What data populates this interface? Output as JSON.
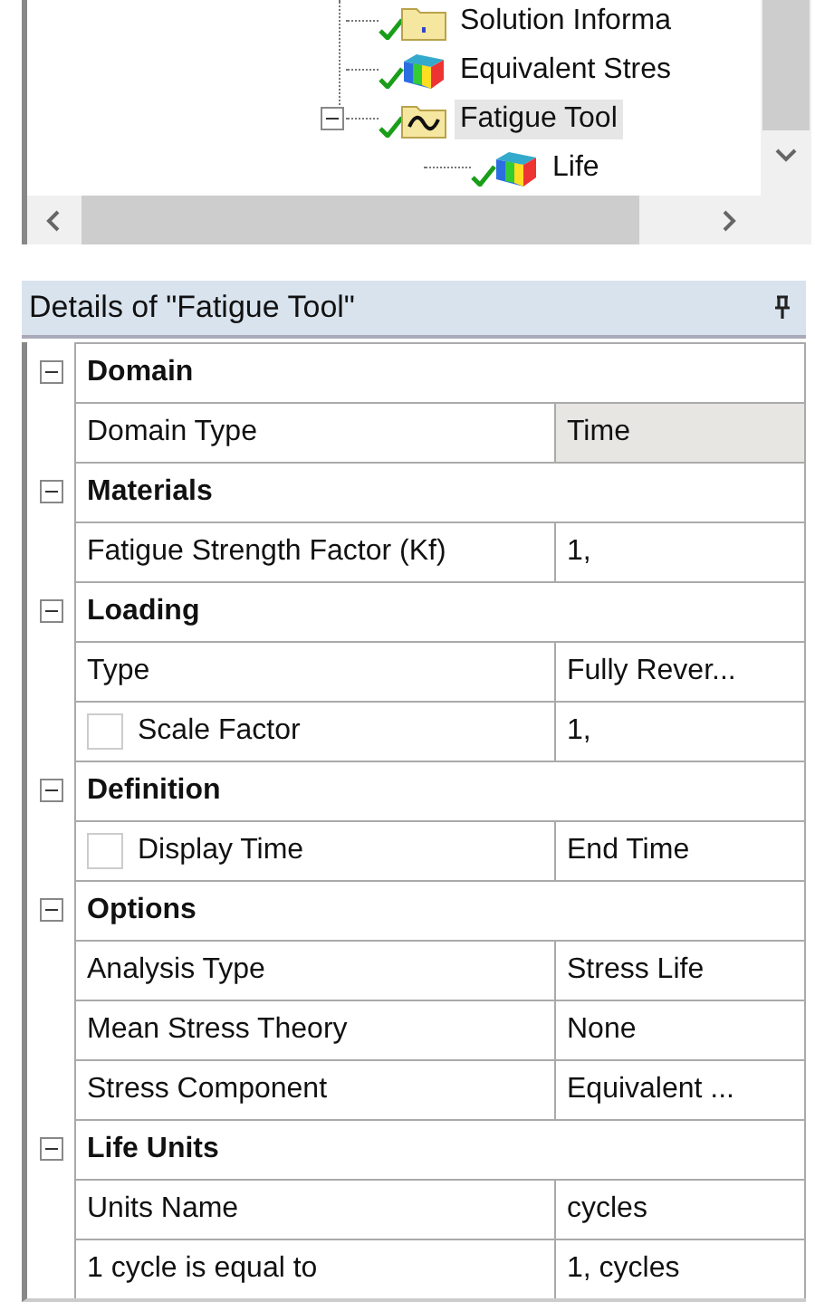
{
  "tree": {
    "items": [
      {
        "label": "Solution Informa",
        "kind": "solution",
        "selected": false
      },
      {
        "label": "Equivalent Stres",
        "kind": "result",
        "selected": false
      },
      {
        "label": "Fatigue Tool",
        "kind": "tool",
        "selected": true,
        "expanded": true,
        "children": [
          {
            "label": "Life",
            "kind": "result",
            "selected": false
          }
        ]
      }
    ]
  },
  "details": {
    "title": "Details of \"Fatigue Tool\"",
    "groups": [
      {
        "name": "Domain",
        "expanded": true,
        "rows": [
          {
            "label": "Domain Type",
            "value": "Time",
            "highlighted": true
          }
        ]
      },
      {
        "name": "Materials",
        "expanded": true,
        "rows": [
          {
            "label": "Fatigue Strength Factor (Kf)",
            "value": "1,",
            "highlighted": false
          }
        ]
      },
      {
        "name": "Loading",
        "expanded": true,
        "rows": [
          {
            "label": "Type",
            "value": "Fully Rever...",
            "highlighted": false
          },
          {
            "label": "Scale Factor",
            "value": "1,",
            "highlighted": false,
            "kind": "checkbox",
            "checked": false
          }
        ]
      },
      {
        "name": "Definition",
        "expanded": true,
        "rows": [
          {
            "label": "Display Time",
            "value": "End Time",
            "highlighted": false,
            "kind": "checkbox",
            "checked": false
          }
        ]
      },
      {
        "name": "Options",
        "expanded": true,
        "rows": [
          {
            "label": "Analysis Type",
            "value": "Stress Life",
            "highlighted": false
          },
          {
            "label": "Mean Stress Theory",
            "value": "None",
            "highlighted": false
          },
          {
            "label": "Stress Component",
            "value": "Equivalent ...",
            "highlighted": false
          }
        ]
      },
      {
        "name": "Life Units",
        "expanded": true,
        "rows": [
          {
            "label": "Units Name",
            "value": "cycles",
            "highlighted": false
          },
          {
            "label": "1 cycle is equal to",
            "value": "1, cycles",
            "highlighted": false
          }
        ]
      }
    ]
  }
}
